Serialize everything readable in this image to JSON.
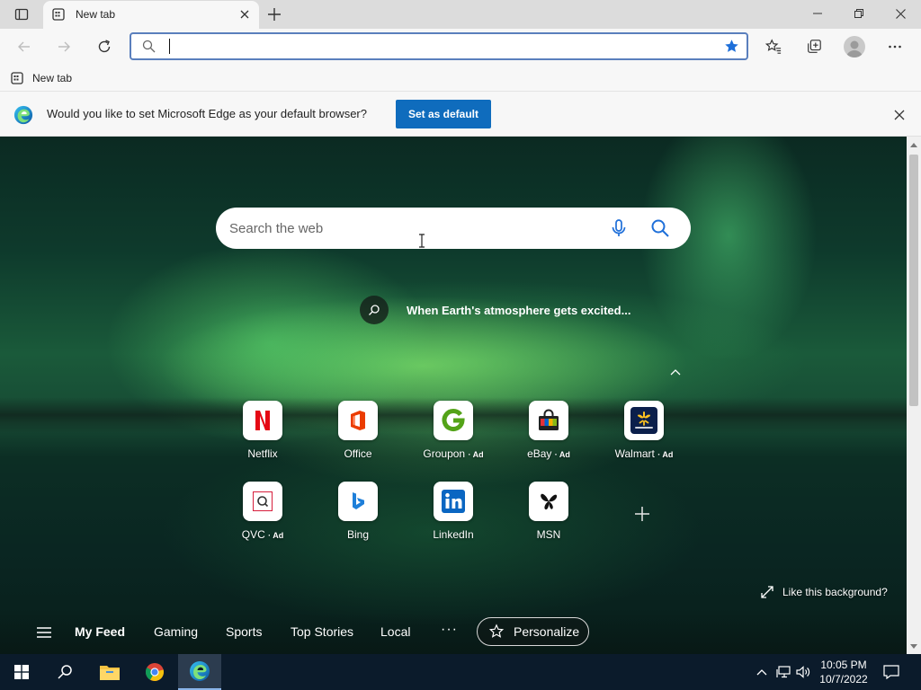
{
  "tab": {
    "title": "New tab"
  },
  "address_bar": {
    "value": "",
    "placeholder": ""
  },
  "favorites_bar": {
    "items": [
      {
        "label": "New tab"
      }
    ]
  },
  "infobar": {
    "message": "Would you like to set Microsoft Edge as your default browser?",
    "button_label": "Set as default"
  },
  "search": {
    "placeholder": "Search the web"
  },
  "promo": {
    "text": "When Earth's atmosphere gets excited..."
  },
  "tiles": [
    {
      "label": "Netflix",
      "ad": ""
    },
    {
      "label": "Office",
      "ad": ""
    },
    {
      "label": "Groupon",
      "ad": "· Ad"
    },
    {
      "label": "eBay",
      "ad": "· Ad"
    },
    {
      "label": "Walmart",
      "ad": "· Ad"
    },
    {
      "label": "QVC",
      "ad": "· Ad"
    },
    {
      "label": "Bing",
      "ad": ""
    },
    {
      "label": "LinkedIn",
      "ad": ""
    },
    {
      "label": "MSN",
      "ad": ""
    }
  ],
  "background": {
    "like_text": "Like this background?"
  },
  "feed": {
    "tabs": [
      "My Feed",
      "Gaming",
      "Sports",
      "Top Stories",
      "Local"
    ],
    "more": "···",
    "personalize_label": "Personalize"
  },
  "taskbar": {
    "time": "10:05 PM",
    "date": "10/7/2022"
  },
  "colors": {
    "accent": "#0f6cbd",
    "favorite_star": "#1e6fd9",
    "tab_strip": "#dcdcdc",
    "taskbar": "#0b1b2b"
  }
}
